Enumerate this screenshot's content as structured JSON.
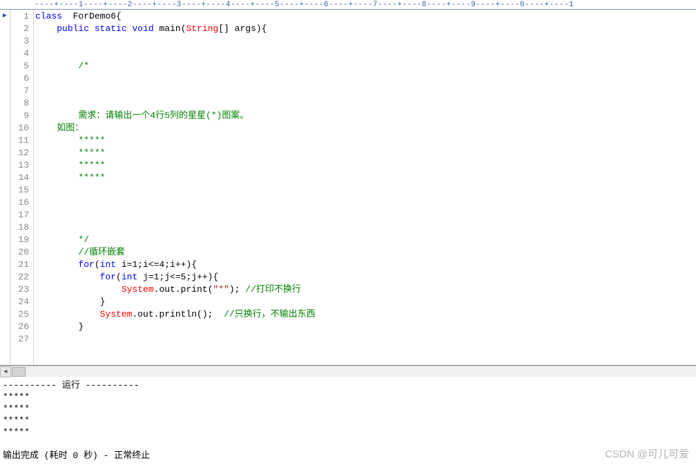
{
  "ruler_text": "----+----1----+----2----+----3----+----4----+----5----+----6----+----7----+----8----+----9----+----0----+----1",
  "lines": [
    {
      "n": "1",
      "tokens": [
        {
          "t": "class",
          "c": "kw"
        },
        {
          "t": "  ForDemo6{",
          "c": ""
        }
      ]
    },
    {
      "n": "2",
      "tokens": [
        {
          "t": "    ",
          "c": ""
        },
        {
          "t": "public",
          "c": "kw"
        },
        {
          "t": " ",
          "c": ""
        },
        {
          "t": "static",
          "c": "kw"
        },
        {
          "t": " ",
          "c": ""
        },
        {
          "t": "void",
          "c": "kw"
        },
        {
          "t": " main(",
          "c": ""
        },
        {
          "t": "String",
          "c": "type"
        },
        {
          "t": "[] args){",
          "c": ""
        }
      ]
    },
    {
      "n": "3",
      "tokens": []
    },
    {
      "n": "4",
      "tokens": []
    },
    {
      "n": "5",
      "tokens": [
        {
          "t": "        /*",
          "c": "cmt"
        }
      ]
    },
    {
      "n": "6",
      "tokens": []
    },
    {
      "n": "7",
      "tokens": []
    },
    {
      "n": "8",
      "tokens": []
    },
    {
      "n": "9",
      "tokens": [
        {
          "t": "        需求：请输出一个4行5列的星星(*)图案。",
          "c": "cmt"
        }
      ]
    },
    {
      "n": "10",
      "tokens": [
        {
          "t": "    如图：",
          "c": "cmt"
        }
      ]
    },
    {
      "n": "11",
      "tokens": [
        {
          "t": "        *****",
          "c": "cmt"
        }
      ]
    },
    {
      "n": "12",
      "tokens": [
        {
          "t": "        *****",
          "c": "cmt"
        }
      ]
    },
    {
      "n": "13",
      "tokens": [
        {
          "t": "        *****",
          "c": "cmt"
        }
      ]
    },
    {
      "n": "14",
      "tokens": [
        {
          "t": "        *****",
          "c": "cmt"
        }
      ]
    },
    {
      "n": "15",
      "tokens": []
    },
    {
      "n": "16",
      "tokens": []
    },
    {
      "n": "17",
      "tokens": []
    },
    {
      "n": "18",
      "tokens": []
    },
    {
      "n": "19",
      "tokens": [
        {
          "t": "        */",
          "c": "cmt"
        }
      ]
    },
    {
      "n": "20",
      "tokens": [
        {
          "t": "        ",
          "c": ""
        },
        {
          "t": "//循环嵌套",
          "c": "cmt"
        }
      ]
    },
    {
      "n": "21",
      "tokens": [
        {
          "t": "        ",
          "c": ""
        },
        {
          "t": "for",
          "c": "kw"
        },
        {
          "t": "(",
          "c": ""
        },
        {
          "t": "int",
          "c": "kw"
        },
        {
          "t": " i=1;i<=4;i++){",
          "c": ""
        }
      ]
    },
    {
      "n": "22",
      "tokens": [
        {
          "t": "            ",
          "c": ""
        },
        {
          "t": "for",
          "c": "kw"
        },
        {
          "t": "(",
          "c": ""
        },
        {
          "t": "int",
          "c": "kw"
        },
        {
          "t": " j=1;j<=5;j++){",
          "c": ""
        }
      ]
    },
    {
      "n": "23",
      "tokens": [
        {
          "t": "                ",
          "c": ""
        },
        {
          "t": "System",
          "c": "type"
        },
        {
          "t": ".out.print(",
          "c": ""
        },
        {
          "t": "\"*\"",
          "c": "str"
        },
        {
          "t": "); ",
          "c": ""
        },
        {
          "t": "//打印不换行",
          "c": "cmt"
        }
      ]
    },
    {
      "n": "24",
      "tokens": [
        {
          "t": "            }",
          "c": ""
        }
      ]
    },
    {
      "n": "25",
      "tokens": [
        {
          "t": "            ",
          "c": ""
        },
        {
          "t": "System",
          "c": "type"
        },
        {
          "t": ".out.println();  ",
          "c": ""
        },
        {
          "t": "//只换行，不输出东西",
          "c": "cmt"
        }
      ]
    },
    {
      "n": "26",
      "tokens": [
        {
          "t": "        }",
          "c": ""
        }
      ]
    },
    {
      "n": "27",
      "tokens": []
    }
  ],
  "output": "---------- 运行 ----------\n*****\n*****\n*****\n*****\n\n输出完成 (耗时 0 秒) - 正常终止",
  "watermark": "CSDN @可儿可爱"
}
